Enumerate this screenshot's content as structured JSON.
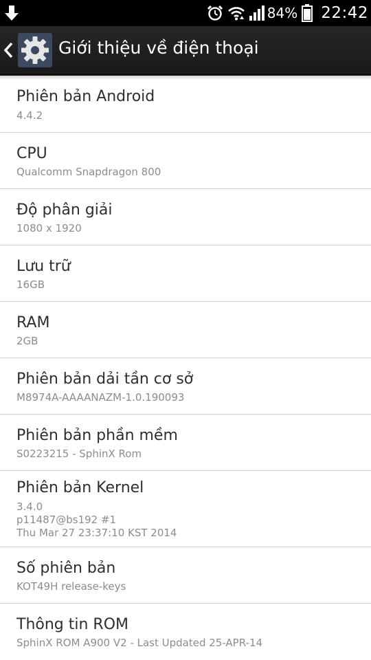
{
  "status_bar": {
    "battery_percent": "84%",
    "time": "22:42",
    "icons": [
      "download-icon",
      "alarm-icon",
      "wifi-icon",
      "signal-icon",
      "battery-icon"
    ]
  },
  "action_bar": {
    "title": "Giới thiệu về điện thoại",
    "icons": [
      "back-chevron-icon",
      "settings-gear-icon"
    ]
  },
  "items": [
    {
      "title": "Phiên bản Android",
      "summary": "4.4.2"
    },
    {
      "title": "CPU",
      "summary": "Qualcomm Snapdragon 800"
    },
    {
      "title": "Độ phân giải",
      "summary": "1080 x 1920"
    },
    {
      "title": "Lưu trữ",
      "summary": "16GB"
    },
    {
      "title": "RAM",
      "summary": "2GB"
    },
    {
      "title": "Phiên bản dải tần cơ sở",
      "summary": "M8974A-AAAANAZM-1.0.190093"
    },
    {
      "title": "Phiên bản phần mềm",
      "summary": "S0223215 - SphinX Rom"
    },
    {
      "title": "Phiên bản Kernel",
      "summary": "3.4.0\np11487@bs192 #1\nThu Mar 27 23:37:10 KST 2014"
    },
    {
      "title": "Số phiên bản",
      "summary": "KOT49H release-keys"
    },
    {
      "title": "Thông tin ROM",
      "summary": "SphinX ROM A900 V2 - Last Updated 25-APR-14"
    }
  ]
}
